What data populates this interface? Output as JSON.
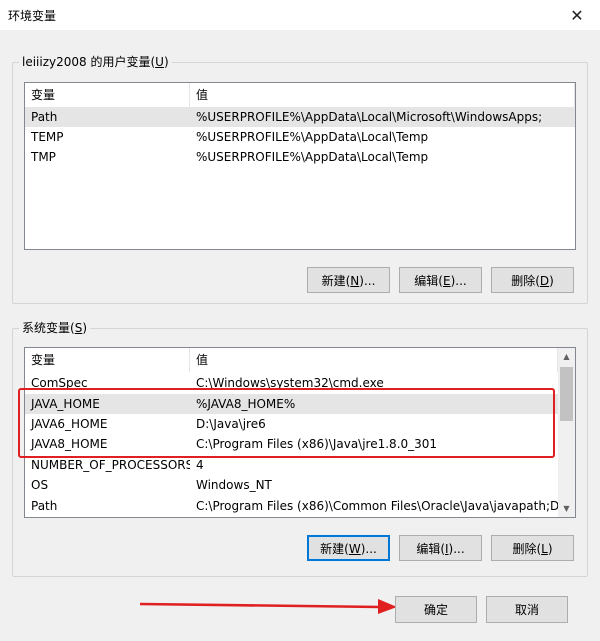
{
  "window": {
    "title": "环境变量",
    "close_glyph": "✕"
  },
  "user_vars": {
    "legend": "leiiizy2008 的用户变量(",
    "legend_key": "U",
    "legend_end": ")",
    "columns": [
      "变量",
      "值"
    ],
    "rows": [
      {
        "name": "Path",
        "value": "%USERPROFILE%\\AppData\\Local\\Microsoft\\WindowsApps;"
      },
      {
        "name": "TEMP",
        "value": "%USERPROFILE%\\AppData\\Local\\Temp"
      },
      {
        "name": "TMP",
        "value": "%USERPROFILE%\\AppData\\Local\\Temp"
      }
    ],
    "buttons": {
      "new": {
        "pre": "新建(",
        "key": "N",
        "post": ")..."
      },
      "edit": {
        "pre": "编辑(",
        "key": "E",
        "post": ")..."
      },
      "delete": {
        "pre": "删除(",
        "key": "D",
        "post": ")"
      }
    }
  },
  "system_vars": {
    "legend": "系统变量(",
    "legend_key": "S",
    "legend_end": ")",
    "columns": [
      "变量",
      "值"
    ],
    "rows": [
      {
        "name": "ComSpec",
        "value": "C:\\Windows\\system32\\cmd.exe"
      },
      {
        "name": "JAVA_HOME",
        "value": "%JAVA8_HOME%"
      },
      {
        "name": "JAVA6_HOME",
        "value": "D:\\Java\\jre6"
      },
      {
        "name": "JAVA8_HOME",
        "value": "C:\\Program Files (x86)\\Java\\jre1.8.0_301"
      },
      {
        "name": "NUMBER_OF_PROCESSORS",
        "value": "4"
      },
      {
        "name": "OS",
        "value": "Windows_NT"
      },
      {
        "name": "Path",
        "value": "C:\\Program Files (x86)\\Common Files\\Oracle\\Java\\javapath;D:..."
      }
    ],
    "buttons": {
      "new": {
        "pre": "新建(",
        "key": "W",
        "post": ")..."
      },
      "edit": {
        "pre": "编辑(",
        "key": "I",
        "post": ")..."
      },
      "delete": {
        "pre": "删除(",
        "key": "L",
        "post": ")"
      }
    }
  },
  "footer": {
    "ok": "确定",
    "cancel": "取消"
  },
  "colors": {
    "highlight": "#e02020",
    "focus": "#0078d7"
  }
}
